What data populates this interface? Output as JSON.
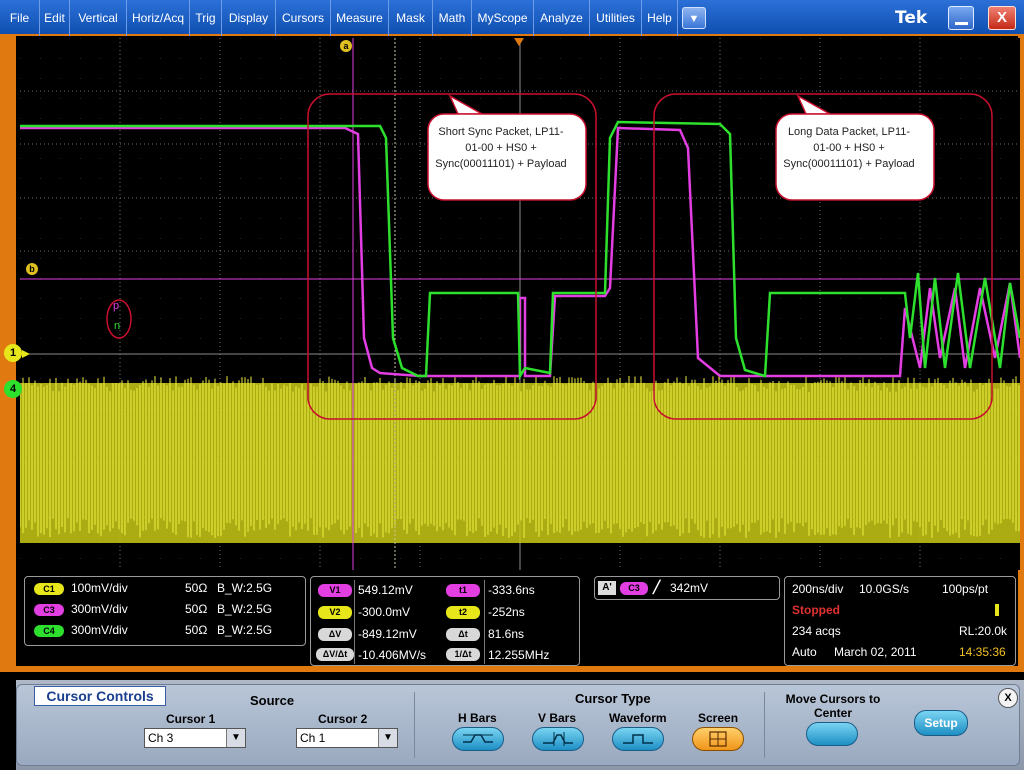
{
  "menu": [
    "File",
    "Edit",
    "Vertical",
    "Horiz/Acq",
    "Trig",
    "Display",
    "Cursors",
    "Measure",
    "Mask",
    "Math",
    "MyScope",
    "Analyze",
    "Utilities",
    "Help"
  ],
  "menu_dropdown": "▼",
  "brand": "Tek",
  "window": {
    "minimize": "—",
    "close": "X"
  },
  "markers": {
    "cursor_a": "a",
    "cursor_b": "b",
    "ch1": "1",
    "ch4": "4",
    "p": "p",
    "n": "n"
  },
  "annotations": [
    {
      "text": "Short Sync Packet, LP11-01-00 + HS0 + Sync(00011101) + Payload"
    },
    {
      "text": "Long Data Packet, LP11-01-00 + HS0 + Sync(00011101) + Payload"
    }
  ],
  "channels": [
    {
      "badge": "C1",
      "scale": "100mV/div",
      "imp": "50Ω",
      "bw": "B_W:2.5G",
      "color": "#e6e61a"
    },
    {
      "badge": "C3",
      "scale": "300mV/div",
      "imp": "50Ω",
      "bw": "B_W:2.5G",
      "color": "#e23ee2"
    },
    {
      "badge": "C4",
      "scale": "300mV/div",
      "imp": "50Ω",
      "bw": "B_W:2.5G",
      "color": "#2ee02e"
    }
  ],
  "cursor_readout": {
    "v1": {
      "label": "V1",
      "value": "549.12mV"
    },
    "v2": {
      "label": "V2",
      "value": "-300.0mV"
    },
    "dv": {
      "label": "ΔV",
      "value": "-849.12mV"
    },
    "dvdt": {
      "label": "ΔV/Δt",
      "value": "-10.406MV/s"
    },
    "t1": {
      "label": "t1",
      "value": "-333.6ns"
    },
    "t2": {
      "label": "t2",
      "value": "-252ns"
    },
    "dt": {
      "label": "Δt",
      "value": "81.6ns"
    },
    "inv_dt": {
      "label": "1/Δt",
      "value": "12.255MHz"
    }
  },
  "trigger": {
    "mode": "A'",
    "source": "C3",
    "slope": "╱",
    "level": "342mV"
  },
  "acquisition": {
    "timebase": "200ns/div",
    "rate": "10.0GS/s",
    "resolution": "100ps/pt",
    "state": "Stopped",
    "acqs": "234 acqs",
    "record_length": "RL:20.0k",
    "mode": "Auto",
    "date": "March 02, 2011",
    "time": "14:35:36"
  },
  "cursor_controls": {
    "title": "Cursor Controls",
    "source_label": "Source",
    "cursor1_label": "Cursor 1",
    "cursor1_value": "Ch 3",
    "cursor2_label": "Cursor 2",
    "cursor2_value": "Ch 1",
    "type_label": "Cursor Type",
    "types": [
      "H Bars",
      "V Bars",
      "Waveform",
      "Screen"
    ],
    "selected_type": "Screen",
    "move_label": "Move Cursors to Center",
    "setup_label": "Setup",
    "close_label": "X"
  },
  "colors": {
    "ch1": "#e6e61a",
    "ch3": "#e23ee2",
    "ch4": "#2ee02e",
    "frame": "#e07a10",
    "menubar": "#1f5fc6",
    "annotation_border": "#c8102e"
  }
}
